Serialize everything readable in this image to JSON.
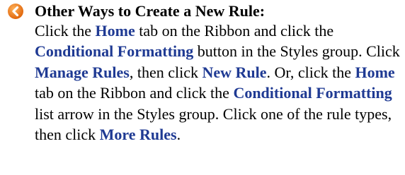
{
  "tip": {
    "icon": "tip-circle-icon",
    "icon_color": "#f07f1e",
    "title": "Other Ways to Create a New Rule:",
    "keyword_color": "#1f3a93",
    "body_segments": [
      {
        "text": "Click the ",
        "bold": false
      },
      {
        "text": "Home",
        "bold": true
      },
      {
        "text": " tab on the Ribbon and click the ",
        "bold": false
      },
      {
        "text": "Conditional Formatting",
        "bold": true
      },
      {
        "text": " button in the Styles group. Click ",
        "bold": false
      },
      {
        "text": "Manage Rules",
        "bold": true
      },
      {
        "text": ", then click ",
        "bold": false
      },
      {
        "text": "New Rule",
        "bold": true
      },
      {
        "text": ". Or, click the ",
        "bold": false
      },
      {
        "text": "Home",
        "bold": true
      },
      {
        "text": " tab on the Ribbon and click the ",
        "bold": false
      },
      {
        "text": "Conditional Formatting",
        "bold": true
      },
      {
        "text": " list arrow in the Styles group. Click one of the rule types, then click ",
        "bold": false
      },
      {
        "text": "More Rules",
        "bold": true
      },
      {
        "text": ".",
        "bold": false
      }
    ]
  }
}
